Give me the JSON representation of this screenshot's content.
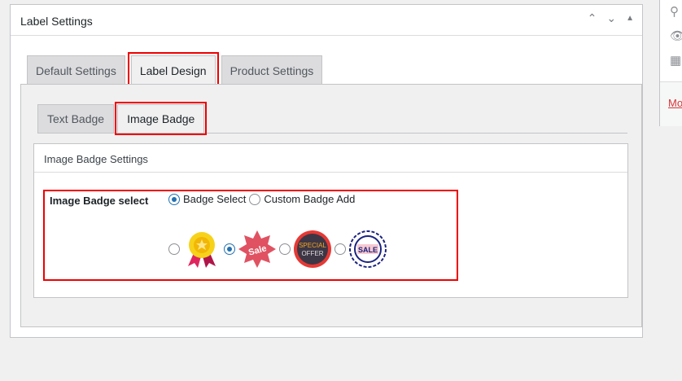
{
  "panel": {
    "title": "Label Settings"
  },
  "tabs": [
    "Default Settings",
    "Label Design",
    "Product Settings"
  ],
  "subtabs": [
    "Text Badge",
    "Image Badge"
  ],
  "box": {
    "title": "Image Badge Settings",
    "field_label": "Image Badge select",
    "options": [
      "Badge Select",
      "Custom Badge Add"
    ],
    "selected_option": "Badge Select",
    "badges": [
      "award-medal",
      "Sale",
      "SPECIAL OFFER",
      "SALE"
    ],
    "selected_badge": 1
  },
  "sidebar": {
    "more": "Mo"
  }
}
